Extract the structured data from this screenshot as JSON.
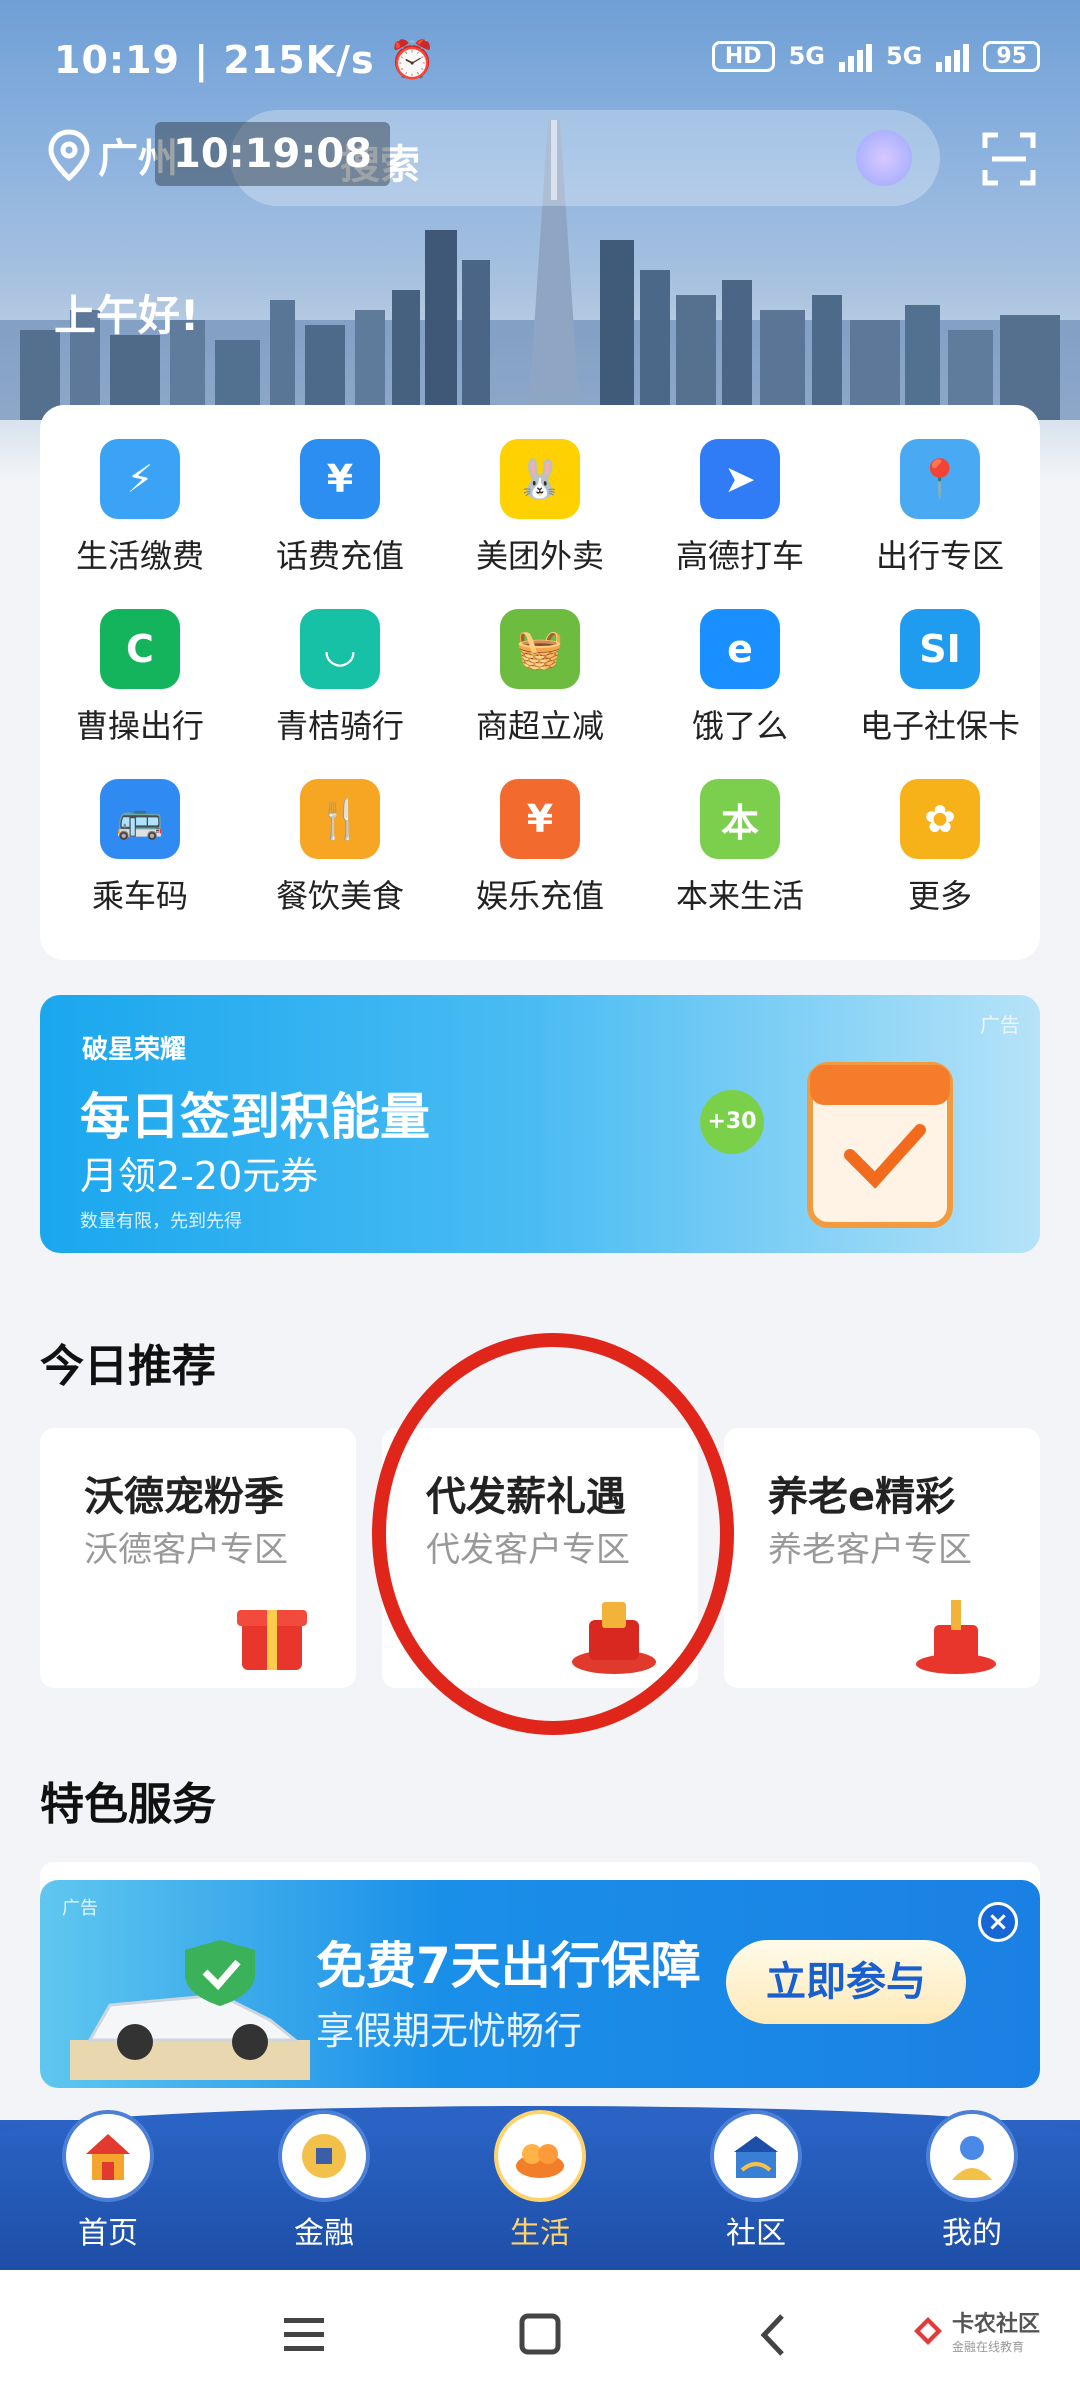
{
  "status_bar": {
    "time": "10:19",
    "speed": "215K/s",
    "network_1": "5G",
    "network_2": "5G",
    "battery": "95"
  },
  "header": {
    "location": "广州",
    "timestamp_overlay": "10:19:08",
    "search_label": "搜索",
    "greeting": "上午好!"
  },
  "services": [
    {
      "label": "生活缴费",
      "icon": "bolt-icon",
      "color": "#3aa3f5",
      "glyph": "⚡"
    },
    {
      "label": "话费充值",
      "icon": "phone-icon",
      "color": "#2b8ef0",
      "glyph": "¥"
    },
    {
      "label": "美团外卖",
      "icon": "meituan-icon",
      "color": "#ffd100",
      "glyph": "🐰"
    },
    {
      "label": "高德打车",
      "icon": "amap-icon",
      "color": "#2f7cf6",
      "glyph": "➤"
    },
    {
      "label": "出行专区",
      "icon": "map-pin-icon",
      "color": "#4aa9f3",
      "glyph": "📍"
    },
    {
      "label": "曹操出行",
      "icon": "caocao-icon",
      "color": "#13b45b",
      "glyph": "C"
    },
    {
      "label": "青桔骑行",
      "icon": "qingju-icon",
      "color": "#17c1a6",
      "glyph": "◡"
    },
    {
      "label": "商超立减",
      "icon": "basket-icon",
      "color": "#6dbb3f",
      "glyph": "🧺"
    },
    {
      "label": "饿了么",
      "icon": "eleme-icon",
      "color": "#1a8fff",
      "glyph": "e"
    },
    {
      "label": "电子社保卡",
      "icon": "si-card-icon",
      "color": "#1f9bf0",
      "glyph": "SI"
    },
    {
      "label": "乘车码",
      "icon": "bus-icon",
      "color": "#2f8af2",
      "glyph": "🚌"
    },
    {
      "label": "餐饮美食",
      "icon": "dining-icon",
      "color": "#f6a623",
      "glyph": "🍴"
    },
    {
      "label": "娱乐充值",
      "icon": "video-icon",
      "color": "#f26a2e",
      "glyph": "¥"
    },
    {
      "label": "本来生活",
      "icon": "benlai-icon",
      "color": "#7ccf4c",
      "glyph": "本"
    },
    {
      "label": "更多",
      "icon": "more-icon",
      "color": "#f7b21a",
      "glyph": "✿"
    }
  ],
  "banner_signin": {
    "brand": "破星荣耀",
    "title": "每日签到积能量",
    "subtitle": "月领2-20元券",
    "fineprint": "数量有限，先到先得",
    "ad_tag": "广告",
    "badge": "+30"
  },
  "recommend": {
    "section_title": "今日推荐",
    "cards": [
      {
        "title": "沃德宠粉季",
        "subtitle": "沃德客户专区"
      },
      {
        "title": "代发薪礼遇",
        "subtitle": "代发客户专区"
      },
      {
        "title": "养老e精彩",
        "subtitle": "养老客户专区"
      }
    ]
  },
  "features": {
    "section_title": "特色服务",
    "banner": {
      "ad_tag": "广告",
      "title": "免费7天出行保障",
      "subtitle": "享假期无忧畅行",
      "button": "立即参与"
    }
  },
  "tabbar": [
    {
      "label": "首页",
      "icon": "home-icon"
    },
    {
      "label": "金融",
      "icon": "finance-icon"
    },
    {
      "label": "生活",
      "icon": "life-icon",
      "active": true
    },
    {
      "label": "社区",
      "icon": "community-icon"
    },
    {
      "label": "我的",
      "icon": "profile-icon"
    }
  ],
  "watermark": {
    "name": "卡农社区",
    "tagline": "金融在线教育"
  }
}
